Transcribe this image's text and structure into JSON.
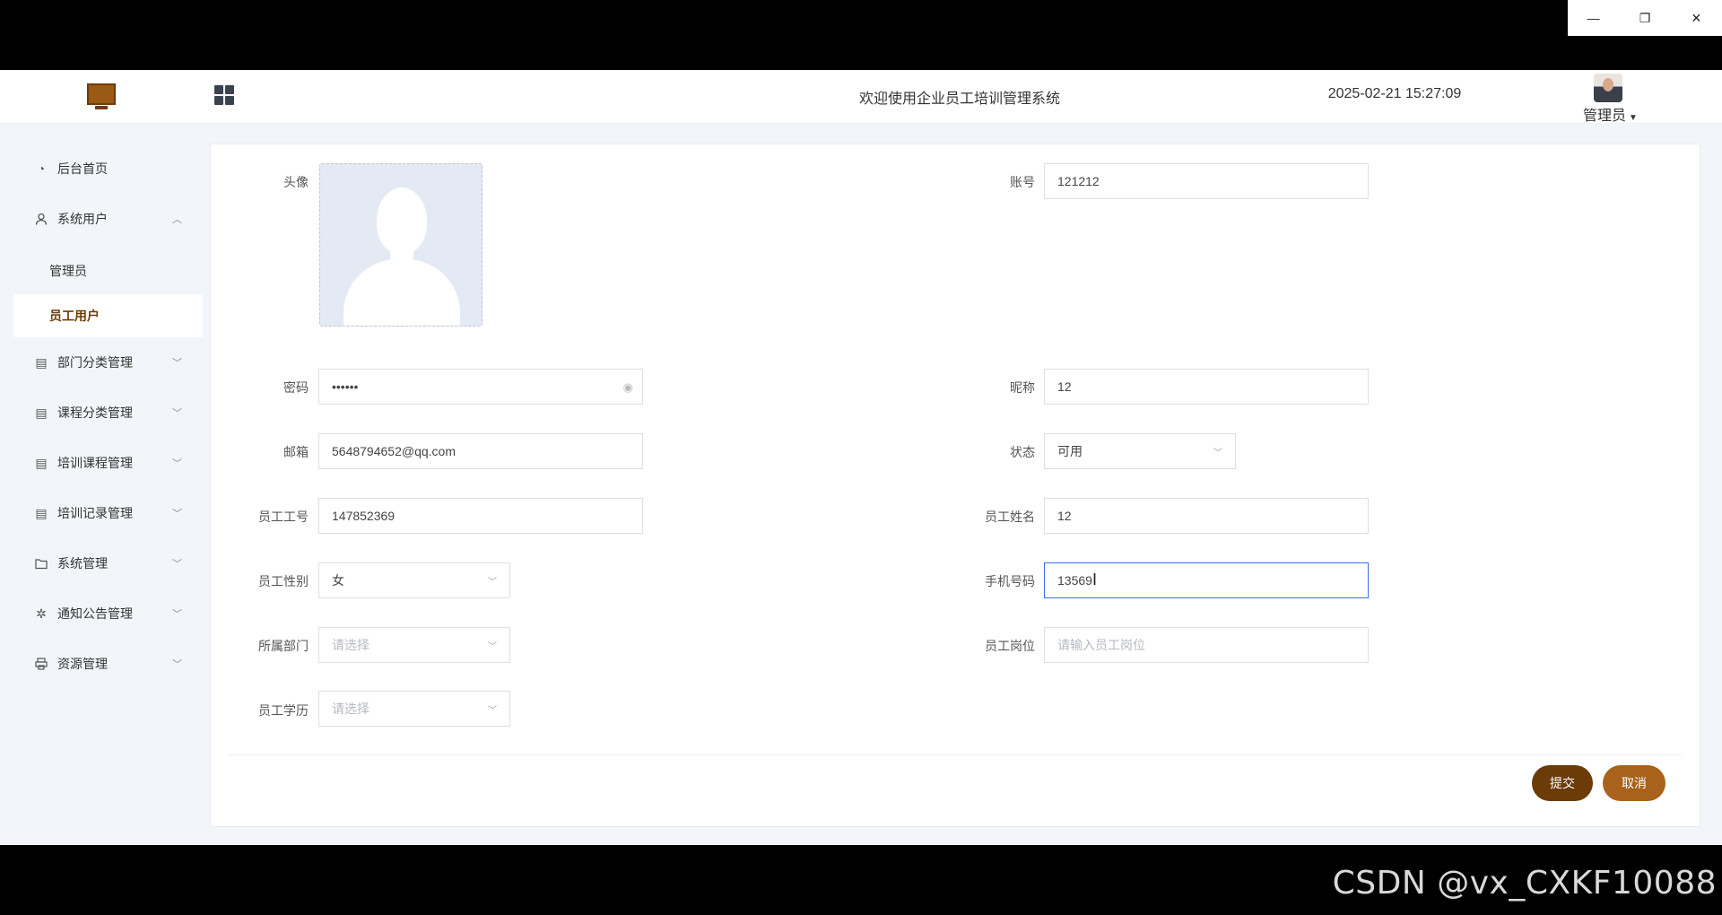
{
  "window_controls": {
    "minimize": "—",
    "restore": "❐",
    "close": "✕"
  },
  "header": {
    "welcome": "欢迎使用企业员工培训管理系统",
    "datetime": "2025-02-21 15:27:09",
    "user": "管理员"
  },
  "sidebar": {
    "items": [
      {
        "label": "后台首页",
        "icon": "clock-icon"
      },
      {
        "label": "系统用户",
        "icon": "user-icon",
        "expanded": true
      },
      {
        "label": "部门分类管理",
        "icon": "list-icon"
      },
      {
        "label": "课程分类管理",
        "icon": "list-icon"
      },
      {
        "label": "培训课程管理",
        "icon": "list-icon"
      },
      {
        "label": "培训记录管理",
        "icon": "list-icon"
      },
      {
        "label": "系统管理",
        "icon": "folder-icon"
      },
      {
        "label": "通知公告管理",
        "icon": "loading-icon"
      },
      {
        "label": "资源管理",
        "icon": "printer-icon"
      }
    ],
    "subitems": [
      {
        "label": "管理员"
      },
      {
        "label": "员工用户",
        "active": true
      }
    ]
  },
  "form": {
    "avatar_label": "头像",
    "account": {
      "label": "账号",
      "value": "121212"
    },
    "password": {
      "label": "密码",
      "value": "••••••"
    },
    "nickname": {
      "label": "昵称",
      "value": "12"
    },
    "email": {
      "label": "邮箱",
      "value": "5648794652@qq.com"
    },
    "status": {
      "label": "状态",
      "value": "可用"
    },
    "emp_no": {
      "label": "员工工号",
      "value": "147852369"
    },
    "emp_name": {
      "label": "员工姓名",
      "value": "12"
    },
    "gender": {
      "label": "员工性别",
      "value": "女"
    },
    "phone": {
      "label": "手机号码",
      "value": "13569"
    },
    "department": {
      "label": "所属部门",
      "placeholder": "请选择"
    },
    "position": {
      "label": "员工岗位",
      "placeholder": "请输入员工岗位"
    },
    "education": {
      "label": "员工学历",
      "placeholder": "请选择"
    }
  },
  "buttons": {
    "submit": "提交",
    "cancel": "取消"
  },
  "watermark": "CSDN @vx_CXKF10088",
  "colors": {
    "primary": "#6b3c07",
    "secondary": "#a8621b",
    "focus": "#3c6ee8"
  }
}
